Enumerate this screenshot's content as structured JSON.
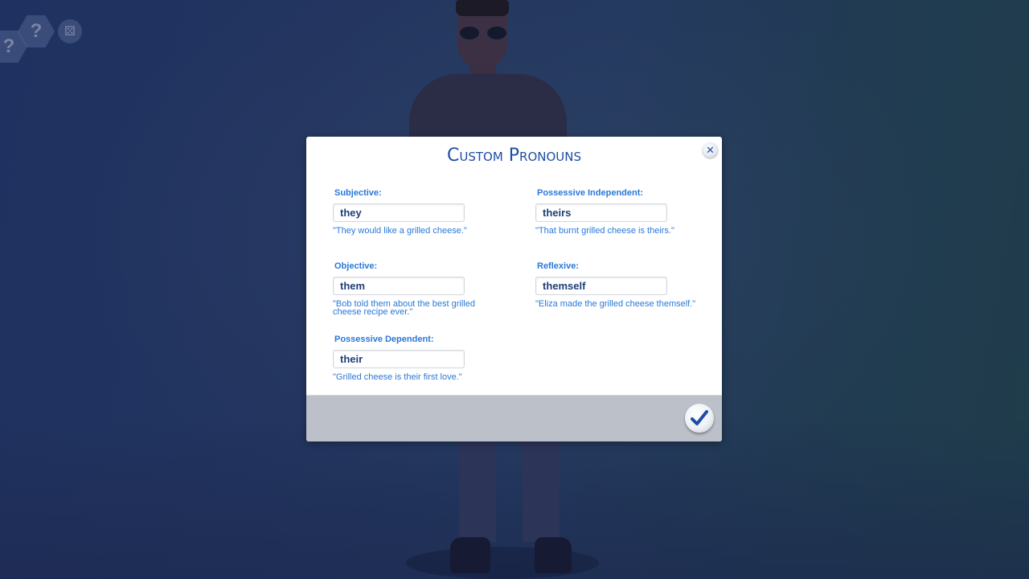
{
  "hud": {
    "help_buttons": [
      {
        "label": "?",
        "icon": "question-icon"
      },
      {
        "label": "?",
        "icon": "question-icon"
      }
    ],
    "dice_icon": "dice-icon",
    "dice_glyph": "⚄"
  },
  "dialog": {
    "title": "Custom Pronouns",
    "close_glyph": "✕",
    "fields": [
      {
        "id": "subjective",
        "label": "Subjective:",
        "value": "they",
        "example": "\"They would like a grilled cheese.\""
      },
      {
        "id": "possessive-independent",
        "label": "Possessive Independent:",
        "value": "theirs",
        "example": "\"That burnt grilled cheese is theirs.\""
      },
      {
        "id": "objective",
        "label": "Objective:",
        "value": "them",
        "example": "\"Bob told them about the best grilled cheese recipe ever.\""
      },
      {
        "id": "reflexive",
        "label": "Reflexive:",
        "value": "themself",
        "example": "\"Eliza made the grilled cheese themself.\""
      },
      {
        "id": "possessive-dependent",
        "label": "Possessive Dependent:",
        "value": "their",
        "example": "\"Grilled cheese is their first love.\""
      }
    ],
    "confirm_icon": "checkmark-icon"
  },
  "colors": {
    "accent": "#1d4ea5",
    "label_blue": "#2a78d8",
    "footer": "#bcc0c9"
  }
}
